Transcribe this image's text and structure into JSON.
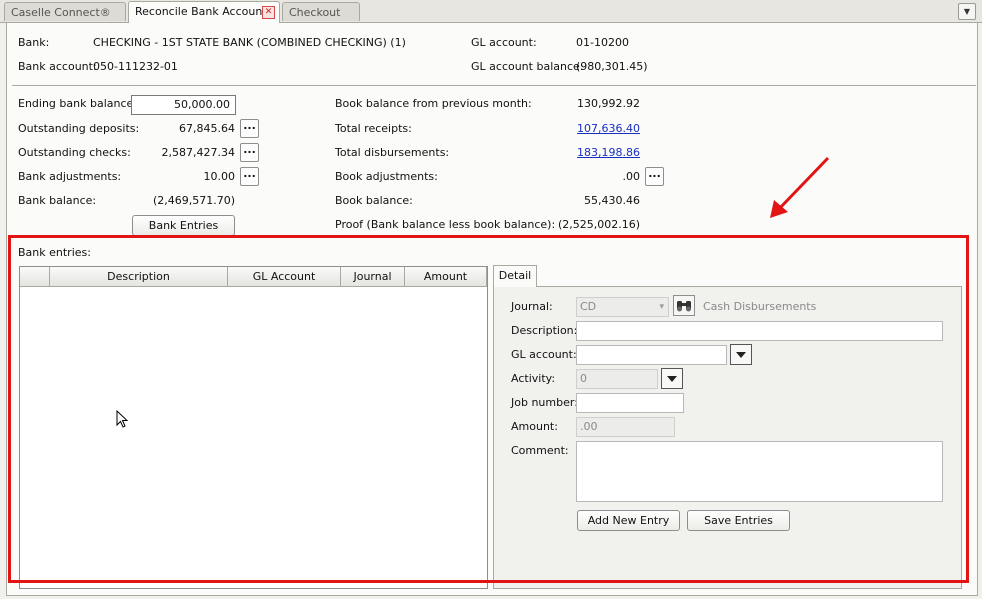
{
  "tabs": [
    {
      "label": "Caselle Connect®"
    },
    {
      "label": "Reconcile Bank Accounts"
    },
    {
      "label": "Checkout"
    }
  ],
  "header": {
    "bank_label": "Bank:",
    "bank_value": "CHECKING - 1ST STATE BANK (COMBINED CHECKING) (1)",
    "bank_account_label": "Bank account:",
    "bank_account_value": "050-111232-01",
    "gl_account_label": "GL account:",
    "gl_account_value": "01-10200",
    "gl_balance_label": "GL account balance:",
    "gl_balance_value": "(980,301.45)"
  },
  "bank_side": {
    "ending_balance_label": "Ending bank balance:",
    "ending_balance_value": "50,000.00",
    "outstanding_deposits_label": "Outstanding deposits:",
    "outstanding_deposits_value": "67,845.64",
    "outstanding_checks_label": "Outstanding checks:",
    "outstanding_checks_value": "2,587,427.34",
    "bank_adjustments_label": "Bank adjustments:",
    "bank_adjustments_value": "10.00",
    "bank_balance_label": "Bank balance:",
    "bank_balance_value": "(2,469,571.70)",
    "bank_entries_button": "Bank Entries",
    "dots": "..."
  },
  "book_side": {
    "prev_month_label": "Book balance from previous month:",
    "prev_month_value": "130,992.92",
    "total_receipts_label": "Total receipts:",
    "total_receipts_value": "107,636.40",
    "total_disbursements_label": "Total disbursements:",
    "total_disbursements_value": "183,198.86",
    "book_adjustments_label": "Book adjustments:",
    "book_adjustments_value": ".00",
    "book_balance_label": "Book balance:",
    "book_balance_value": "55,430.46",
    "proof_label": "Proof (Bank balance less book balance):",
    "proof_value": "(2,525,002.16)"
  },
  "bank_entries": {
    "section_label": "Bank entries:",
    "columns": [
      "Description",
      "GL Account",
      "Journal",
      "Amount"
    ],
    "rows": []
  },
  "detail": {
    "tab_label": "Detail",
    "journal_label": "Journal:",
    "journal_value": "CD",
    "journal_name": "Cash Disbursements",
    "description_label": "Description:",
    "description_value": "",
    "gl_account_label": "GL account:",
    "gl_account_value": "",
    "activity_label": "Activity:",
    "activity_value": "0",
    "job_number_label": "Job number:",
    "job_number_value": "",
    "amount_label": "Amount:",
    "amount_value": ".00",
    "comment_label": "Comment:",
    "comment_value": "",
    "add_button": "Add New Entry",
    "save_button": "Save Entries"
  },
  "colors": {
    "highlight": "#e21414",
    "link": "#1a2fbf"
  }
}
